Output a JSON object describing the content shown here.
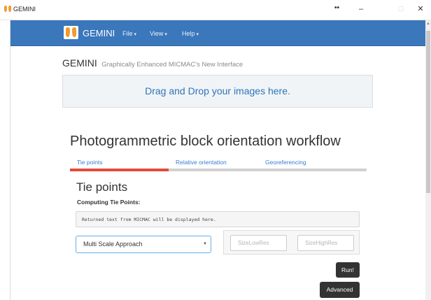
{
  "window": {
    "title": "GEMINI",
    "dots": "••",
    "minimize": "–",
    "maximize": "□",
    "close": "✕"
  },
  "navbar": {
    "brand": "GEMINI",
    "menus": [
      {
        "label": "File"
      },
      {
        "label": "View"
      },
      {
        "label": "Help"
      }
    ],
    "caret": "▾"
  },
  "header": {
    "app_name": "GEMINI",
    "subtitle": "Graphically Enhanced MICMAC's New Interface"
  },
  "dropzone": {
    "text": "Drag and Drop your images here."
  },
  "workflow": {
    "title": "Photogrammetric block orientation workflow",
    "steps": [
      {
        "label": "Tie points"
      },
      {
        "label": "Relative orientation"
      },
      {
        "label": "Georeferencing"
      }
    ],
    "progress_fraction": 0.333
  },
  "tie_points": {
    "title": "Tie points",
    "subtitle": "Computing Tie Points:",
    "console_text": "Returned text from MICMAC will be displayed here.",
    "method_selected": "Multi Scale Approach",
    "size_low_placeholder": "SizeLowRes",
    "size_high_placeholder": "SizeHighRes",
    "run_label": "Run!",
    "advanced_label": "Advanced"
  },
  "colors": {
    "navbar": "#3a77bb",
    "accent_link": "#3a7bd5",
    "progress_active": "#e14b3b",
    "progress_track": "#d0d0d0",
    "dark_button": "#333333",
    "logo_orange": "#f29a2e"
  },
  "icons": {
    "app_logo": "twin-orange-shapes-logo",
    "select_caret": "caret-down"
  }
}
